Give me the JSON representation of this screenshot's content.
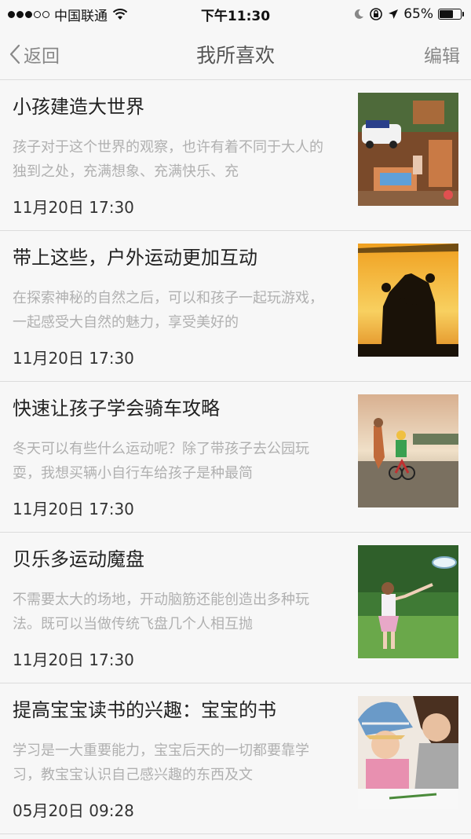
{
  "status_bar": {
    "carrier": "中国联通",
    "time": "下午11:30",
    "battery": "65%",
    "battery_level": 0.65,
    "signal_dots": 3,
    "signal_total": 5
  },
  "nav": {
    "back_label": "返回",
    "title": "我所喜欢",
    "edit_label": "编辑"
  },
  "items": [
    {
      "title": "小孩建造大世界",
      "summary": "孩子对于这个世界的观察，也许有着不同于大人的独到之处，充满想象、充满快乐、充",
      "date": "11月20日 17:30"
    },
    {
      "title": "带上这些，户外运动更加互动",
      "summary": "在探索神秘的自然之后，可以和孩子一起玩游戏，一起感受大自然的魅力，享受美好的",
      "date": "11月20日 17:30"
    },
    {
      "title": "快速让孩子学会骑车攻略",
      "summary": "冬天可以有些什么运动呢？除了带孩子去公园玩耍，我想买辆小自行车给孩子是种最简",
      "date": "11月20日 17:30"
    },
    {
      "title": "贝乐多运动魔盘",
      "summary": "不需要太大的场地，开动脑筋还能创造出多种玩法。既可以当做传统飞盘几个人相互抛",
      "date": "11月20日 17:30"
    },
    {
      "title": "提高宝宝读书的兴趣：宝宝的书",
      "summary": "学习是一大重要能力，宝宝后天的一切都要靠学习，教宝宝认识自己感兴趣的东西及文",
      "date": "05月20日 09:28"
    }
  ]
}
